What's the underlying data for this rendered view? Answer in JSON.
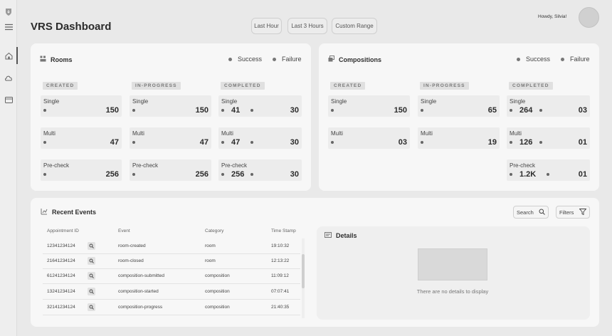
{
  "header": {
    "title": "VRS Dashboard",
    "ranges": [
      "Last Hour",
      "Last 3 Hours",
      "Custom Range"
    ],
    "greeting": "Howdy, Silvia!"
  },
  "rail": {
    "icons": [
      "shield-icon",
      "menu-icon",
      "home-icon",
      "cloud-icon",
      "card-icon"
    ]
  },
  "legend": {
    "success": "Success",
    "failure": "Failure"
  },
  "rooms": {
    "title": "Rooms",
    "created_label": "CREATED",
    "inprogress_label": "IN-PROGRESS",
    "completed_label": "COMPLETED",
    "created": [
      {
        "label": "Single",
        "value": "150"
      },
      {
        "label": "Multi",
        "value": "47"
      },
      {
        "label": "Pre-check",
        "value": "256"
      }
    ],
    "inprogress": [
      {
        "label": "Single",
        "value": "150"
      },
      {
        "label": "Multi",
        "value": "47"
      },
      {
        "label": "Pre-check",
        "value": "256"
      }
    ],
    "completed": [
      {
        "label": "Single",
        "success": "41",
        "failure": "30"
      },
      {
        "label": "Multi",
        "success": "47",
        "failure": "30"
      },
      {
        "label": "Pre-check",
        "success": "256",
        "failure": "30"
      }
    ]
  },
  "compositions": {
    "title": "Compositions",
    "created_label": "CREATED",
    "inprogress_label": "IN-PROGRESS",
    "completed_label": "COMPLETED",
    "created": [
      {
        "label": "Single",
        "value": "150"
      },
      {
        "label": "Multi",
        "value": "03"
      }
    ],
    "inprogress": [
      {
        "label": "Single",
        "value": "65"
      },
      {
        "label": "Multi",
        "value": "19"
      }
    ],
    "completed": [
      {
        "label": "Single",
        "success": "264",
        "failure": "03"
      },
      {
        "label": "Multi",
        "success": "126",
        "failure": "01"
      },
      {
        "label": "Pre-check",
        "success": "1.2K",
        "failure": "01"
      }
    ]
  },
  "events": {
    "title": "Recent Events",
    "search_label": "Search",
    "filters_label": "Filters",
    "columns": [
      "Appointment ID",
      "Event",
      "Category",
      "Time Stamp"
    ],
    "rows": [
      {
        "id": "12341234124",
        "event": "room-created",
        "category": "room",
        "time": "19:10:32"
      },
      {
        "id": "21641234124",
        "event": "room-closed",
        "category": "room",
        "time": "12:13:22"
      },
      {
        "id": "61241234124",
        "event": "composition-submitted",
        "category": "composition",
        "time": "11:09:12"
      },
      {
        "id": "13241234124",
        "event": "composition-started",
        "category": "composition",
        "time": "07:07:41"
      },
      {
        "id": "32141234124",
        "event": "composition-progress",
        "category": "composition",
        "time": "21:40:35"
      }
    ]
  },
  "details": {
    "title": "Details",
    "empty_text": "There are no details to display"
  }
}
